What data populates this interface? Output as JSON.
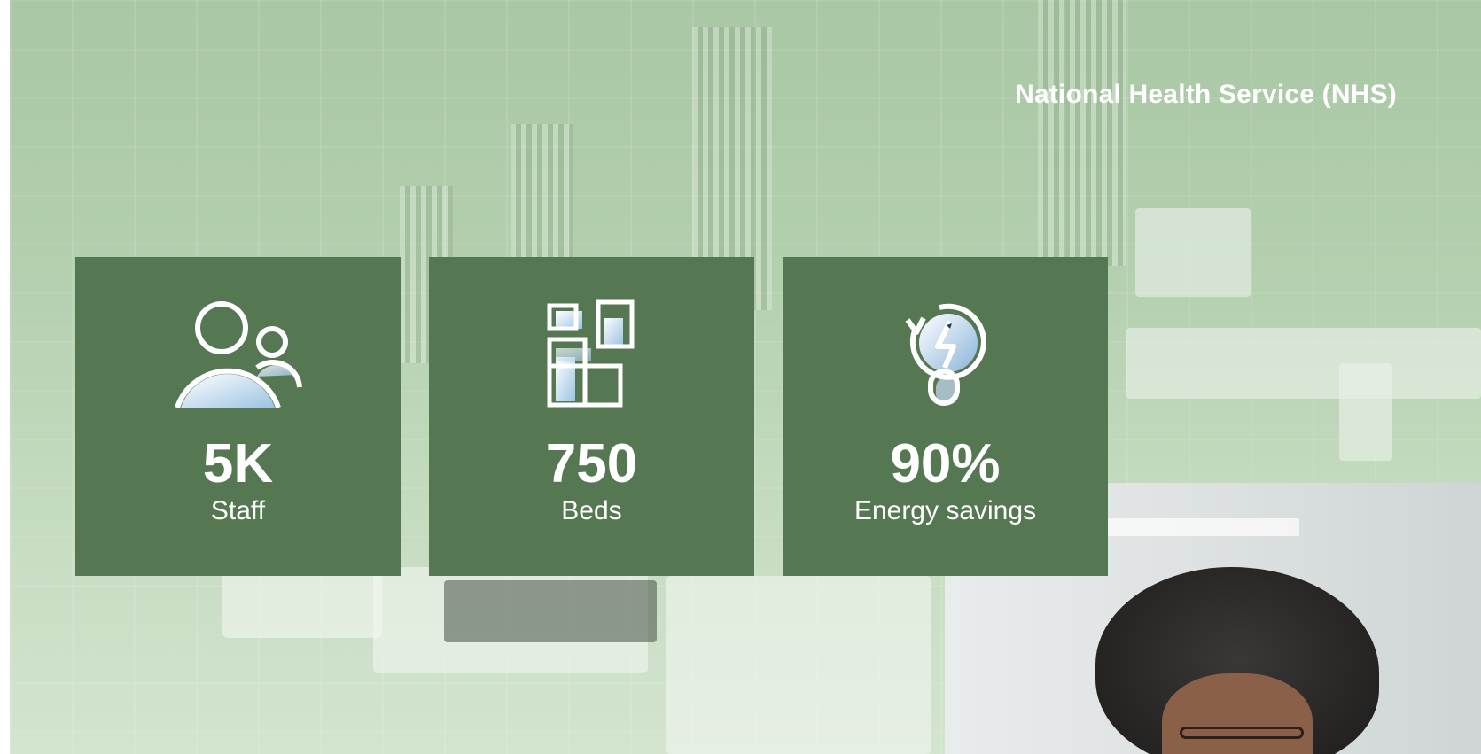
{
  "header": {
    "title": "National Health Service (NHS)"
  },
  "stats": [
    {
      "value": "5K",
      "label": "Staff",
      "icon": "people-icon"
    },
    {
      "value": "750",
      "label": "Beds",
      "icon": "layout-blocks-icon"
    },
    {
      "value": "90%",
      "label": "Energy savings",
      "icon": "energy-bulb-icon"
    }
  ],
  "colors": {
    "card_background": "#557852",
    "overlay_tint": "#a9c7a4",
    "text": "#ffffff",
    "icon_fill": "#bcd8ec"
  }
}
